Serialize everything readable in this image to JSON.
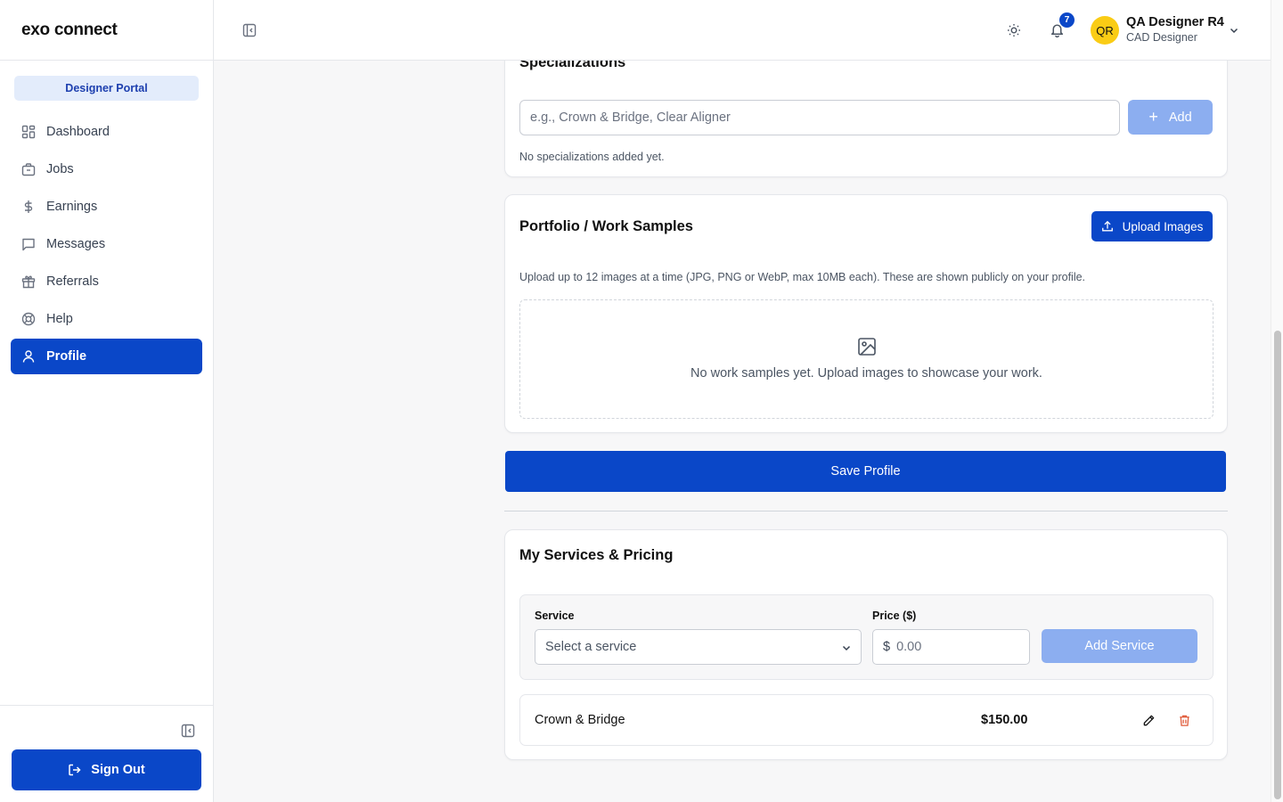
{
  "app": {
    "brand": "exo connect",
    "portal_label": "Designer Portal"
  },
  "sidebar": {
    "items": [
      {
        "label": "Dashboard",
        "icon": "dashboard-icon"
      },
      {
        "label": "Jobs",
        "icon": "briefcase-icon"
      },
      {
        "label": "Earnings",
        "icon": "dollar-icon"
      },
      {
        "label": "Messages",
        "icon": "message-icon"
      },
      {
        "label": "Referrals",
        "icon": "gift-icon"
      },
      {
        "label": "Help",
        "icon": "lifebuoy-icon"
      },
      {
        "label": "Profile",
        "icon": "user-icon",
        "active": true
      }
    ],
    "sign_out": "Sign Out"
  },
  "header": {
    "notification_count": "7",
    "user": {
      "initials": "QR",
      "name": "QA Designer R4",
      "role": "CAD Designer"
    }
  },
  "specializations": {
    "title": "Specializations",
    "input_placeholder": "e.g., Crown & Bridge, Clear Aligner",
    "add_label": "Add",
    "empty_text": "No specializations added yet."
  },
  "portfolio": {
    "title": "Portfolio / Work Samples",
    "upload_label": "Upload Images",
    "description": "Upload up to 12 images at a time (JPG, PNG or WebP, max 10MB each). These are shown publicly on your profile.",
    "empty_text": "No work samples yet. Upload images to showcase your work."
  },
  "save_label": "Save Profile",
  "services": {
    "title": "My Services & Pricing",
    "service_label": "Service",
    "service_placeholder": "Select a service",
    "price_label": "Price ($)",
    "currency": "$",
    "price_placeholder": "0.00",
    "add_label": "Add Service",
    "rows": [
      {
        "name": "Crown & Bridge",
        "price": "$150.00"
      }
    ]
  },
  "colors": {
    "primary": "#0a47c8",
    "primary_disabled": "#8caef0",
    "avatar": "#facc15",
    "danger": "#e05b3a"
  }
}
